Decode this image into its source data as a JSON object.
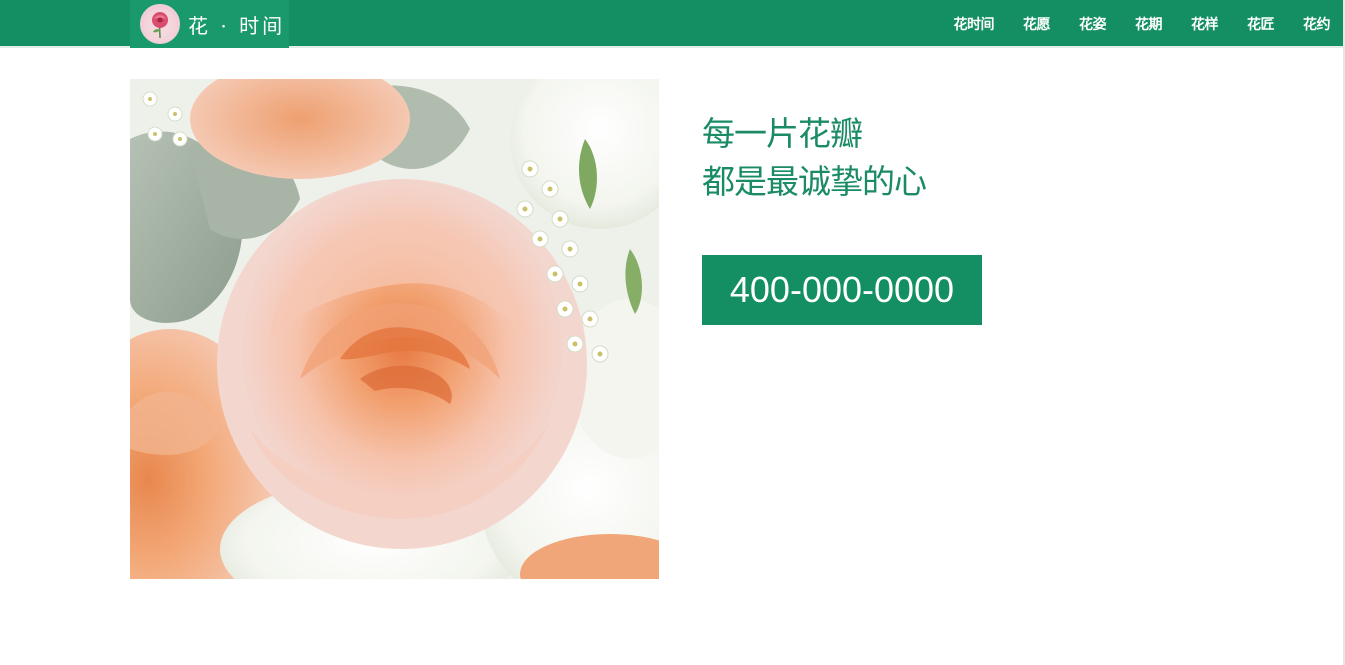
{
  "header": {
    "logo_text": "花 · 时间",
    "logo_icon": "flower-logo-icon",
    "nav_items": [
      "花时间",
      "花愿",
      "花姿",
      "花期",
      "花样",
      "花匠",
      "花约"
    ]
  },
  "hero": {
    "slogan_line1": "每一片花瓣",
    "slogan_line2": "都是最诚挚的心",
    "phone": "400-000-0000"
  },
  "colors": {
    "brand_green": "#138f63",
    "slogan_green": "#1a8b63",
    "background": "#ffffff"
  }
}
